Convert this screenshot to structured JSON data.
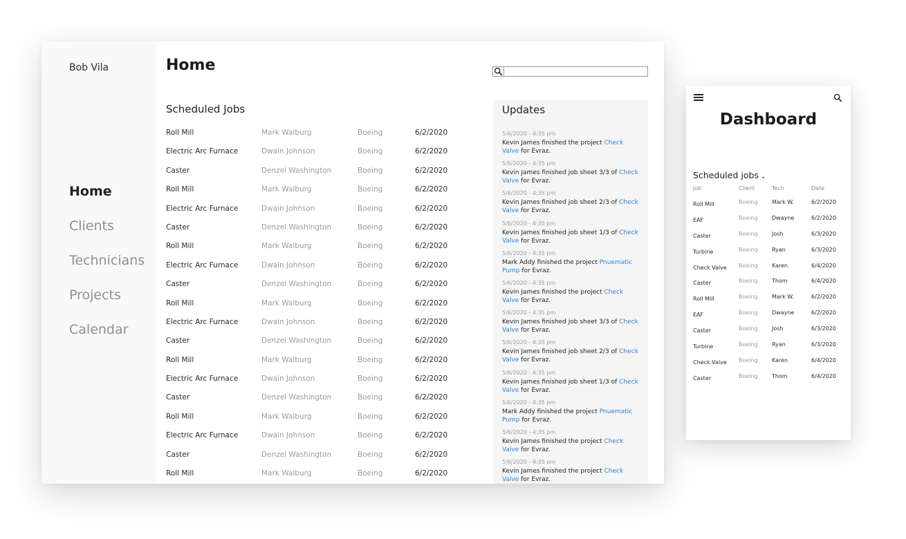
{
  "desktop": {
    "sidebar": {
      "user_name": "Bob Vila",
      "nav": [
        {
          "label": "Home",
          "active": true
        },
        {
          "label": "Clients",
          "active": false
        },
        {
          "label": "Technicians",
          "active": false
        },
        {
          "label": "Projects",
          "active": false
        },
        {
          "label": "Calendar",
          "active": false
        }
      ]
    },
    "page_title": "Home",
    "search": {
      "icon": "search-icon",
      "placeholder": ""
    },
    "scheduled_jobs": {
      "title": "Scheduled Jobs",
      "rows": [
        {
          "job": "Roll Mill",
          "tech": "Mark Walburg",
          "client": "Boeing",
          "date": "6/2/2020"
        },
        {
          "job": "Electric Arc Furnace",
          "tech": "Dwain Johnson",
          "client": "Boeing",
          "date": "6/2/2020"
        },
        {
          "job": "Caster",
          "tech": "Denzel Washington",
          "client": "Boeing",
          "date": "6/2/2020"
        },
        {
          "job": "Roll Mill",
          "tech": "Mark Walburg",
          "client": "Boeing",
          "date": "6/2/2020"
        },
        {
          "job": "Electric Arc Furnace",
          "tech": "Dwain Johnson",
          "client": "Boeing",
          "date": "6/2/2020"
        },
        {
          "job": "Caster",
          "tech": "Denzel Washington",
          "client": "Boeing",
          "date": "6/2/2020"
        },
        {
          "job": "Roll Mill",
          "tech": "Mark Walburg",
          "client": "Boeing",
          "date": "6/2/2020"
        },
        {
          "job": "Electric Arc Furnace",
          "tech": "Dwain Johnson",
          "client": "Boeing",
          "date": "6/2/2020"
        },
        {
          "job": "Caster",
          "tech": "Denzel Washington",
          "client": "Boeing",
          "date": "6/2/2020"
        },
        {
          "job": "Roll Mill",
          "tech": "Mark Walburg",
          "client": "Boeing",
          "date": "6/2/2020"
        },
        {
          "job": "Electric Arc Furnace",
          "tech": "Dwain Johnson",
          "client": "Boeing",
          "date": "6/2/2020"
        },
        {
          "job": "Caster",
          "tech": "Denzel Washington",
          "client": "Boeing",
          "date": "6/2/2020"
        },
        {
          "job": "Roll Mill",
          "tech": "Mark Walburg",
          "client": "Boeing",
          "date": "6/2/2020"
        },
        {
          "job": "Electric Arc Furnace",
          "tech": "Dwain Johnson",
          "client": "Boeing",
          "date": "6/2/2020"
        },
        {
          "job": "Caster",
          "tech": "Denzel Washington",
          "client": "Boeing",
          "date": "6/2/2020"
        },
        {
          "job": "Roll Mill",
          "tech": "Mark Walburg",
          "client": "Boeing",
          "date": "6/2/2020"
        },
        {
          "job": "Electric Arc Furnace",
          "tech": "Dwain Johnson",
          "client": "Boeing",
          "date": "6/2/2020"
        },
        {
          "job": "Caster",
          "tech": "Denzel Washington",
          "client": "Boeing",
          "date": "6/2/2020"
        },
        {
          "job": "Roll Mill",
          "tech": "Mark Walburg",
          "client": "Boeing",
          "date": "6/2/2020"
        }
      ]
    },
    "updates": {
      "title": "Updates",
      "items": [
        {
          "time": "5/6/2020 - 4:35 pm",
          "before": "Kevin James finished the project ",
          "link": "Check Valve",
          "after": " for Evraz."
        },
        {
          "time": "5/6/2020 - 4:35 pm",
          "before": "Kevin James finished job sheet 3/3 of ",
          "link": "Check Valve",
          "after": " for Evraz."
        },
        {
          "time": "5/6/2020 - 4:35 pm",
          "before": "Kevin James finished job sheet 2/3 of ",
          "link": "Check Valve",
          "after": " for Evraz."
        },
        {
          "time": "5/6/2020 - 4:35 pm",
          "before": "Kevin James finished job sheet 1/3 of ",
          "link": "Check Valve",
          "after": " for Evraz."
        },
        {
          "time": "5/6/2020 - 4:35 pm",
          "before": "Mark Addy finished the project ",
          "link": "Pnuematic Pump",
          "after": " for Evraz."
        },
        {
          "time": "5/6/2020 - 4:35 pm",
          "before": "Kevin James finished the project ",
          "link": "Check Valve",
          "after": " for Evraz."
        },
        {
          "time": "5/6/2020 - 4:35 pm",
          "before": "Kevin James finished job sheet 3/3 of ",
          "link": "Check Valve",
          "after": " for Evraz."
        },
        {
          "time": "5/6/2020 - 4:35 pm",
          "before": "Kevin James finished job sheet 2/3 of ",
          "link": "Check Valve",
          "after": " for Evraz."
        },
        {
          "time": "5/6/2020 - 4:35 pm",
          "before": "Kevin James finished job sheet 1/3 of ",
          "link": "Check Valve",
          "after": " for Evraz."
        },
        {
          "time": "5/6/2020 - 4:35 pm",
          "before": "Mark Addy finished the project ",
          "link": "Pnuematic Pump",
          "after": " for Evraz."
        },
        {
          "time": "5/6/2020 - 4:35 pm",
          "before": "Kevin James finished the project ",
          "link": "Check Valve",
          "after": " for Evraz."
        },
        {
          "time": "5/6/2020 - 4:35 pm",
          "before": "Kevin James finished the project ",
          "link": "Check Valve",
          "after": " for Evraz."
        }
      ]
    }
  },
  "mobile": {
    "menu_icon": "hamburger-menu-icon",
    "search_icon": "search-icon",
    "title": "Dashboard",
    "section_label": "Scheduled jobs",
    "section_chevron": "chevron-down-icon",
    "columns": [
      "Job",
      "Client",
      "Tech",
      "Date"
    ],
    "rows": [
      {
        "job": "Roll Mill",
        "client": "Boeing",
        "tech": "Mark W.",
        "date": "6/2/2020"
      },
      {
        "job": "EAF",
        "client": "Boeing",
        "tech": "Dwayne",
        "date": "6/2/2020"
      },
      {
        "job": "Caster",
        "client": "Boeing",
        "tech": "Josh",
        "date": "6/3/2020"
      },
      {
        "job": "Turbine",
        "client": "Boeing",
        "tech": "Ryan",
        "date": "6/3/2020"
      },
      {
        "job": "Check Valve",
        "client": "Boeing",
        "tech": "Karen",
        "date": "6/4/2020"
      },
      {
        "job": "Caster",
        "client": "Boeing",
        "tech": "Thom",
        "date": "6/4/2020"
      },
      {
        "job": "Roll Mill",
        "client": "Boeing",
        "tech": "Mark W.",
        "date": "6/2/2020"
      },
      {
        "job": "EAF",
        "client": "Boeing",
        "tech": "Dwayne",
        "date": "6/2/2020"
      },
      {
        "job": "Caster",
        "client": "Boeing",
        "tech": "Josh",
        "date": "6/3/2020"
      },
      {
        "job": "Turbine",
        "client": "Boeing",
        "tech": "Ryan",
        "date": "6/3/2020"
      },
      {
        "job": "Check Valve",
        "client": "Boeing",
        "tech": "Karen",
        "date": "6/4/2020"
      },
      {
        "job": "Caster",
        "client": "Boeing",
        "tech": "Thom",
        "date": "6/4/2020"
      }
    ]
  },
  "colors": {
    "link": "#2f80d1",
    "muted_text": "#9b9b9b",
    "sidebar_bg": "#f9f9f9",
    "updates_bg": "#f5f5f5"
  }
}
